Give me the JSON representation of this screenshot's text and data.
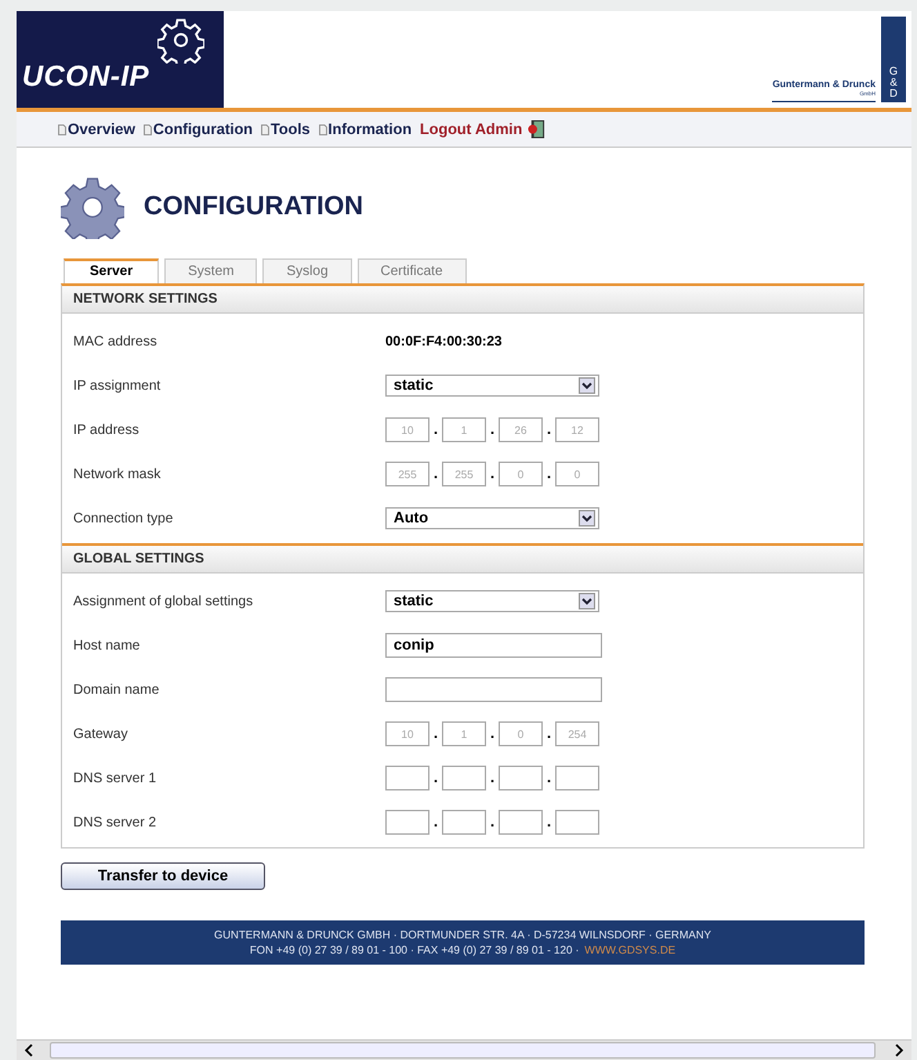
{
  "header": {
    "product": "UCON-IP",
    "company": "Guntermann & Drunck",
    "company_suffix": "GmbH",
    "logo_letters": [
      "G",
      "&",
      "D"
    ]
  },
  "nav": [
    {
      "label": "Overview",
      "kind": "page"
    },
    {
      "label": "Configuration",
      "kind": "page"
    },
    {
      "label": "Tools",
      "kind": "page"
    },
    {
      "label": "Information",
      "kind": "page"
    },
    {
      "label": "Logout Admin",
      "kind": "logout"
    }
  ],
  "title": "CONFIGURATION",
  "tabs": [
    {
      "label": "Server",
      "selected": true
    },
    {
      "label": "System",
      "selected": false
    },
    {
      "label": "Syslog",
      "selected": false
    },
    {
      "label": "Certificate",
      "selected": false
    }
  ],
  "sections": [
    {
      "heading": "NETWORK SETTINGS",
      "rows": [
        {
          "label": "MAC address",
          "kind": "text",
          "value": "00:0F:F4:00:30:23"
        },
        {
          "label": "IP assignment",
          "kind": "select",
          "value": "static"
        },
        {
          "label": "IP address",
          "kind": "ip",
          "octets": [
            "10",
            "1",
            "26",
            "12"
          ],
          "separator": "."
        },
        {
          "label": "Network mask",
          "kind": "ip",
          "octets": [
            "255",
            "255",
            "0",
            "0"
          ],
          "separator": "."
        },
        {
          "label": "Connection type",
          "kind": "select",
          "value": "Auto"
        }
      ]
    },
    {
      "heading": "GLOBAL SETTINGS",
      "rows": [
        {
          "label": "Assignment of global settings",
          "kind": "select",
          "value": "static"
        },
        {
          "label": "Host name",
          "kind": "input",
          "value": "conip"
        },
        {
          "label": "Domain name",
          "kind": "input"
        },
        {
          "label": "Gateway",
          "kind": "ip",
          "octets": [
            "10",
            "1",
            "0",
            "254"
          ],
          "separator": "."
        },
        {
          "label": "DNS server 1",
          "kind": "ip",
          "octets": [],
          "separator": "."
        },
        {
          "label": "DNS server 2",
          "kind": "ip",
          "octets": [],
          "separator": "."
        }
      ]
    }
  ],
  "button": "Transfer to device",
  "footer": {
    "line1": "GUNTERMANN & DRUNCK GMBH · DORTMUNDER STR. 4A · D-57234 WILNSDORF · GERMANY",
    "line2": "FON +49 (0) 27 39 / 89 01 - 100 · FAX +49 (0) 27 39 / 89 01 - 120 ·",
    "link": "WWW.GDSYS.DE"
  }
}
